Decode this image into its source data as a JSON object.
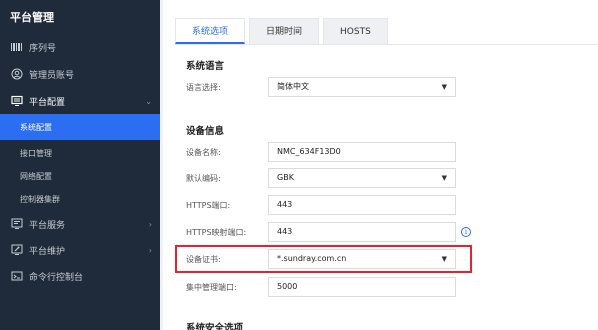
{
  "sidebar": {
    "title": "平台管理",
    "items": [
      {
        "label": "序列号",
        "icon": "barcode-icon"
      },
      {
        "label": "管理员账号",
        "icon": "user-icon"
      },
      {
        "label": "平台配置",
        "icon": "monitor-icon"
      },
      {
        "label": "平台服务",
        "icon": "server-icon"
      },
      {
        "label": "平台维护",
        "icon": "wrench-icon"
      },
      {
        "label": "命令行控制台",
        "icon": "terminal-icon"
      }
    ],
    "subitems": [
      {
        "label": "系统配置",
        "active": true
      },
      {
        "label": "接口管理"
      },
      {
        "label": "网络配置"
      },
      {
        "label": "控制器集群"
      }
    ]
  },
  "tabs": [
    {
      "label": "系统选项",
      "active": true
    },
    {
      "label": "日期时间"
    },
    {
      "label": "HOSTS"
    }
  ],
  "sections": {
    "language": "系统语言",
    "device_info": "设备信息",
    "security": "系统安全选项"
  },
  "fields": {
    "language": {
      "label": "语言选择:",
      "value": "简体中文"
    },
    "device_name": {
      "label": "设备名称:",
      "value": "NMC_634F13D0"
    },
    "encoding": {
      "label": "默认编码:",
      "value": "GBK"
    },
    "https_port": {
      "label": "HTTPS端口:",
      "value": "443"
    },
    "https_map_port": {
      "label": "HTTPS映射端口:",
      "value": "443"
    },
    "certificate": {
      "label": "设备证书:",
      "value": "*.sundray.com.cn"
    },
    "central_port": {
      "label": "集中管理端口:",
      "value": "5000"
    }
  },
  "colors": {
    "accent": "#2c6ef2",
    "sidebar_bg": "#1f2a3a",
    "highlight": "#e3242b"
  }
}
